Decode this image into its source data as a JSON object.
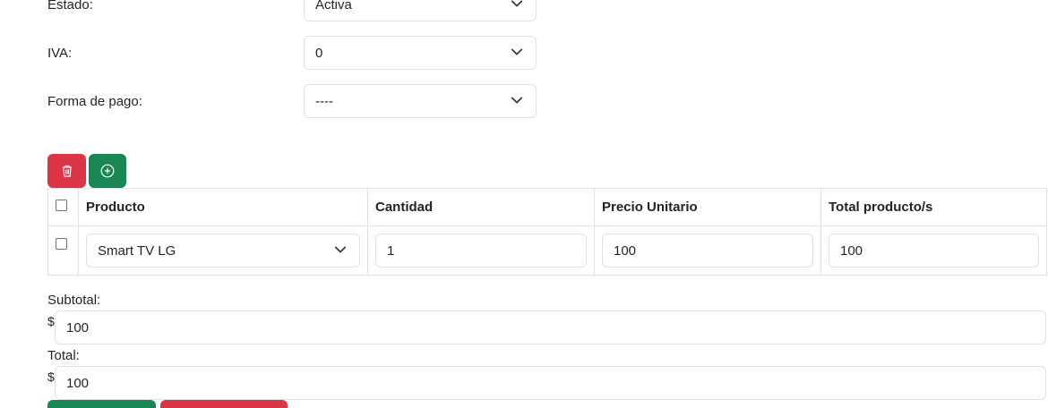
{
  "form": {
    "estado": {
      "label": "Estado:",
      "value": "Activa"
    },
    "iva": {
      "label": "IVA:",
      "value": "0"
    },
    "forma_pago": {
      "label": "Forma de pago:",
      "value": "----"
    }
  },
  "toolbar": {
    "delete_icon": "trash-icon",
    "add_icon": "plus-circle-icon"
  },
  "table": {
    "headers": [
      "Producto",
      "Cantidad",
      "Precio Unitario",
      "Total producto/s"
    ],
    "rows": [
      {
        "producto": "Smart TV LG",
        "cantidad": "1",
        "precio": "100",
        "total": "100"
      }
    ]
  },
  "summary": {
    "subtotal_label": "Subtotal:",
    "subtotal_currency": "$",
    "subtotal_value": "100",
    "total_label": "Total:",
    "total_currency": "$",
    "total_value": "100"
  },
  "colors": {
    "danger": "#dc3545",
    "success": "#198754",
    "border": "#dee2e6"
  }
}
